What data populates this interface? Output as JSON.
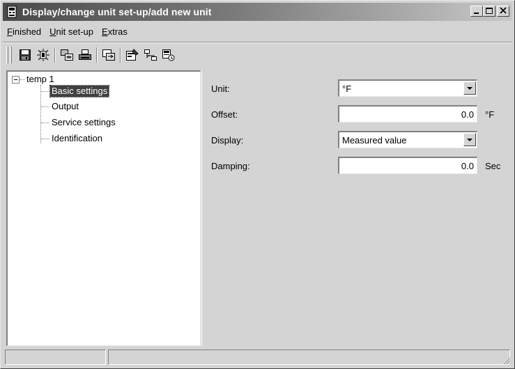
{
  "window": {
    "title": "Display/change unit set-up/add new unit"
  },
  "menu": {
    "items": [
      {
        "label_accel": "F",
        "label_rest": "inished"
      },
      {
        "label_accel": "U",
        "label_rest": "nit set-up"
      },
      {
        "label_accel": "E",
        "label_rest": "xtras"
      }
    ]
  },
  "toolbar": {
    "icons": [
      "save-icon",
      "sensor-icon",
      "transfer-icon",
      "print-icon",
      "compare-icon",
      "properties-icon",
      "network-icon",
      "device-info-icon"
    ]
  },
  "tree": {
    "root": "temp 1",
    "items": [
      {
        "label": "Basic settings",
        "selected": true
      },
      {
        "label": "Output",
        "selected": false
      },
      {
        "label": "Service settings",
        "selected": false
      },
      {
        "label": "Identification",
        "selected": false
      }
    ]
  },
  "form": {
    "unit": {
      "label": "Unit:",
      "value": "°F"
    },
    "offset": {
      "label": "Offset:",
      "value": "0.0",
      "unit": "°F"
    },
    "display": {
      "label": "Display:",
      "value": "Measured value"
    },
    "damping": {
      "label": "Damping:",
      "value": "0.0",
      "unit": "Sec"
    }
  },
  "colors": {
    "title_gradient_start": "#4a4a4a",
    "face": "#d4d4d4",
    "selection": "#404040"
  }
}
